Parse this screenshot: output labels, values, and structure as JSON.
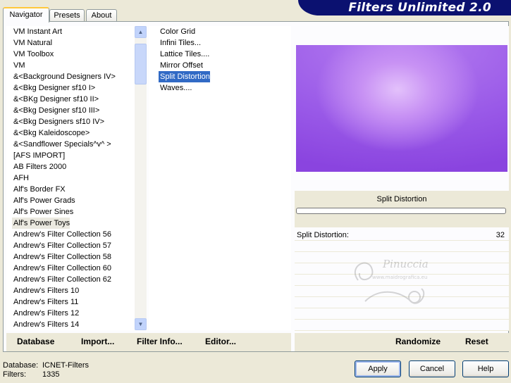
{
  "title": "Filters Unlimited 2.0",
  "tabs": [
    {
      "label": "Navigator",
      "active": true
    },
    {
      "label": "Presets",
      "active": false
    },
    {
      "label": "About",
      "active": false
    }
  ],
  "categories": [
    "VM Instant Art",
    "VM Natural",
    "VM Toolbox",
    "VM",
    "&<Background Designers IV>",
    "&<Bkg Designer sf10 I>",
    "&<BKg Designer sf10 II>",
    "&<Bkg Designer sf10 III>",
    "&<Bkg Designers sf10 IV>",
    "&<Bkg Kaleidoscope>",
    "&<Sandflower Specials^v^ >",
    "[AFS IMPORT]",
    "AB Filters 2000",
    "AFH",
    "Alf's Border FX",
    "Alf's Power Grads",
    "Alf's Power Sines",
    "Alf's Power Toys",
    "Andrew's Filter Collection 56",
    "Andrew's Filter Collection 57",
    "Andrew's Filter Collection 58",
    "Andrew's Filter Collection 60",
    "Andrew's Filter Collection 62",
    "Andrew's Filters 10",
    "Andrew's Filters 11",
    "Andrew's Filters 12",
    "Andrew's Filters 14"
  ],
  "selected_category": "Alf's Power Toys",
  "filters": [
    "Color Grid",
    "Infini Tiles...",
    "Lattice Tiles....",
    "Mirror Offset",
    "Split Distortion",
    "Waves...."
  ],
  "selected_filter": "Split Distortion",
  "preview": {
    "filter_name": "Split Distortion",
    "colors": {
      "light": "#e3c1fb",
      "mid": "#b57df0",
      "dark": "#8a44df"
    }
  },
  "parameters": [
    {
      "label": "Split Distortion:",
      "value": "32"
    }
  ],
  "links": {
    "database": "Database",
    "import": "Import...",
    "filter_info": "Filter Info...",
    "editor": "Editor...",
    "randomize": "Randomize",
    "reset": "Reset"
  },
  "footer": {
    "database_label": "Database:",
    "database_value": "ICNET-Filters",
    "filters_label": "Filters:",
    "filters_value": "1335"
  },
  "buttons": {
    "apply": "Apply",
    "cancel": "Cancel",
    "help": "Help"
  },
  "watermark": {
    "name": "Pinuccia",
    "url": "www.maidrografica.eu"
  }
}
